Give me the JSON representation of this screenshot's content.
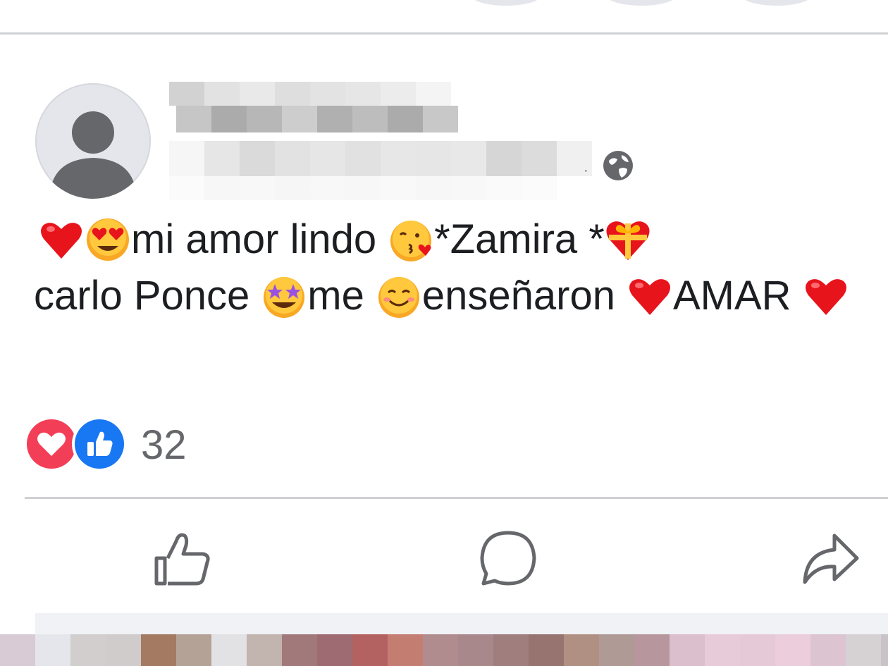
{
  "post": {
    "message": {
      "line1": {
        "seg1": "mi amor lindo",
        "seg2": "*Zamira *"
      },
      "line2": {
        "seg1": "carlo Ponce",
        "seg2": "me",
        "seg3": "enseñaron",
        "seg4": "AMAR"
      }
    },
    "reactions": {
      "count": "32",
      "types": [
        "love-icon",
        "like-icon"
      ]
    },
    "privacy": "globe-icon"
  },
  "actions": {
    "icons": [
      "like-button",
      "comment-button",
      "share-button"
    ]
  },
  "colors": {
    "text": "#1c1e21",
    "secondary_text": "#65676b",
    "like_blue": "#1877f2",
    "love_red": "#f33e58",
    "divider": "#ced0d4"
  }
}
